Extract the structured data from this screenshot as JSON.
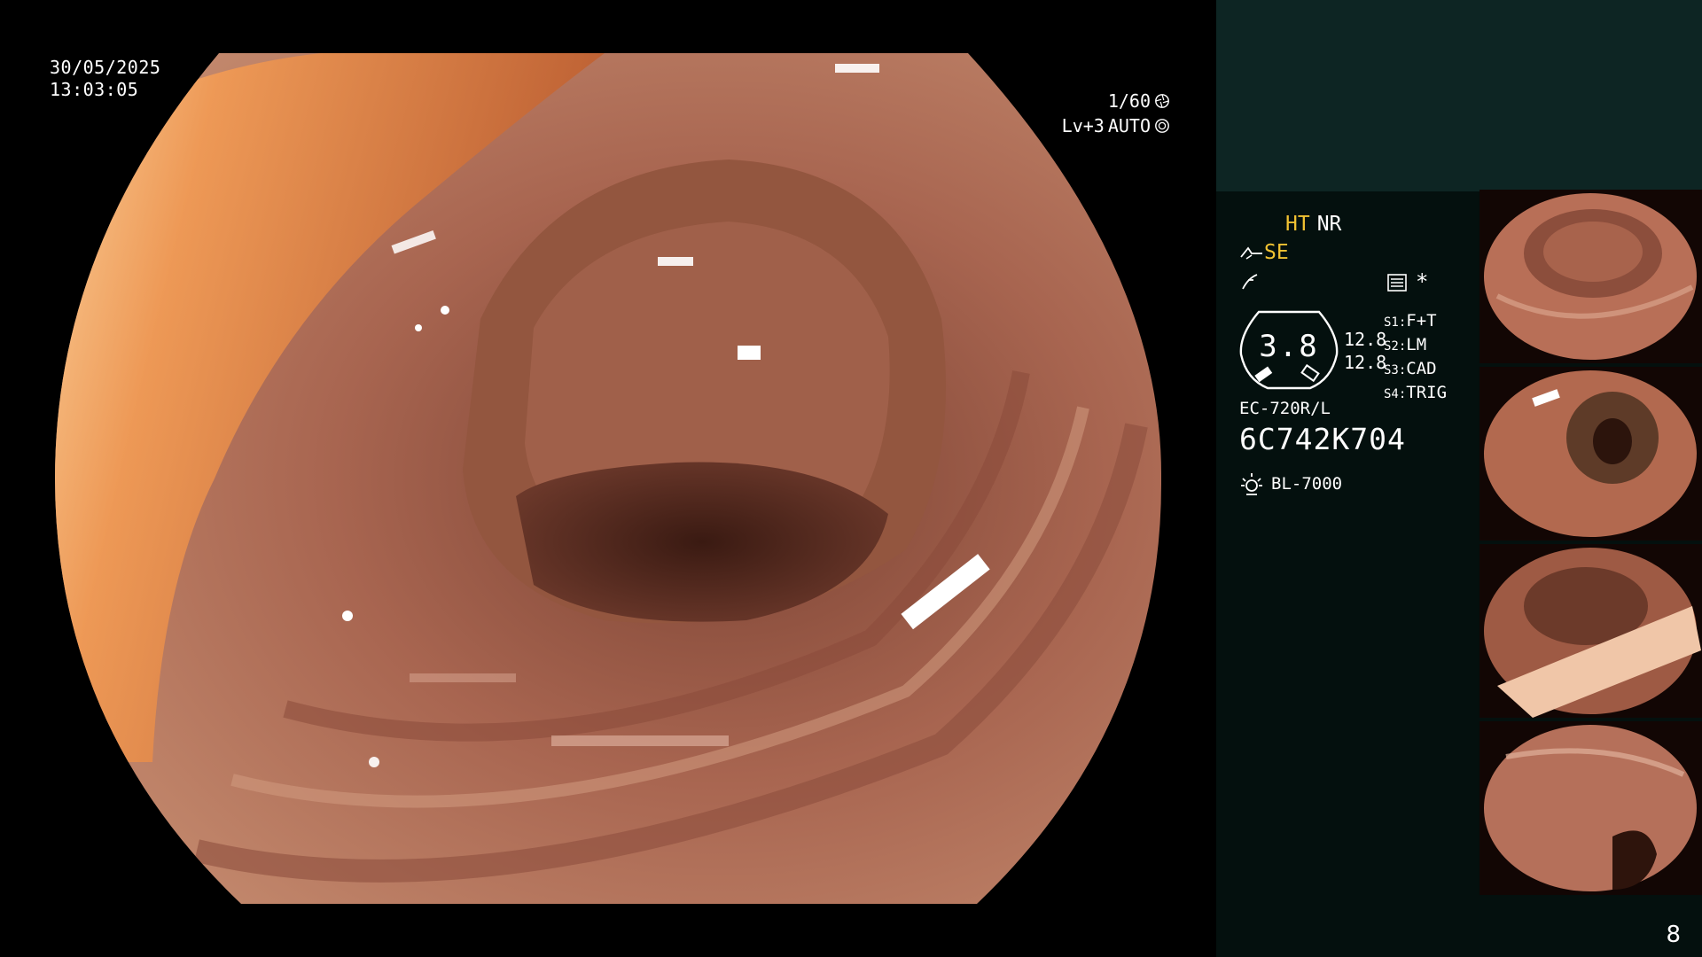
{
  "overlay": {
    "date": "30/05/2025",
    "time": "13:03:05",
    "shutter": "1/60",
    "level": "Lv+3",
    "iris": "AUTO"
  },
  "panel": {
    "ht": "HT",
    "nr": "NR",
    "se": "SE",
    "star": "*",
    "dial_value": "3.8",
    "num_a": "12.8",
    "num_b": "12.8",
    "s_keys": [
      "S1:",
      "S2:",
      "S3:",
      "S4:"
    ],
    "s_values": [
      "F+T",
      "LM",
      "CAD",
      "TRIG"
    ],
    "scope_model": "EC-720R/L",
    "serial": "6C742K704",
    "light_source": "BL-7000"
  },
  "page_number": "8",
  "colors": {
    "highlight": "#f1c232",
    "panel_bg": "#04100e",
    "panel_top": "#0d2523",
    "tissue": "#b8745a"
  },
  "icons": [
    "aperture-icon",
    "iris-icon",
    "scope-icon",
    "filter-icon",
    "menu-icon",
    "light-icon"
  ]
}
